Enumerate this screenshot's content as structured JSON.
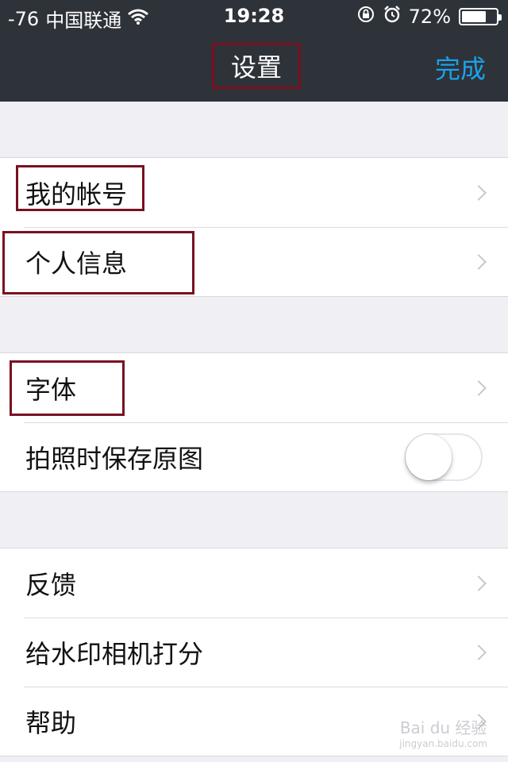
{
  "status_bar": {
    "signal": "-76",
    "carrier": "中国联通",
    "time": "19:28",
    "battery_percent": "72%",
    "battery_level": 0.72,
    "icons": [
      "wifi-icon",
      "rotation-lock-icon",
      "alarm-icon",
      "battery-icon"
    ]
  },
  "nav": {
    "title": "设置",
    "done_label": "完成"
  },
  "sections": [
    {
      "items": [
        {
          "label": "我的帐号",
          "type": "link"
        },
        {
          "label": "个人信息",
          "type": "link"
        }
      ]
    },
    {
      "items": [
        {
          "label": "字体",
          "type": "link"
        },
        {
          "label": "拍照时保存原图",
          "type": "toggle",
          "value": false
        }
      ]
    },
    {
      "items": [
        {
          "label": "反馈",
          "type": "link"
        },
        {
          "label": "给水印相机打分",
          "type": "link"
        },
        {
          "label": "帮助",
          "type": "link"
        }
      ]
    }
  ],
  "watermark": {
    "text": "Bai du 经验",
    "sub": "jingyan.baidu.com"
  },
  "colors": {
    "bar": "#2e3239",
    "accent": "#1aa3e8",
    "highlight": "#7a1020",
    "background": "#efeff4"
  }
}
